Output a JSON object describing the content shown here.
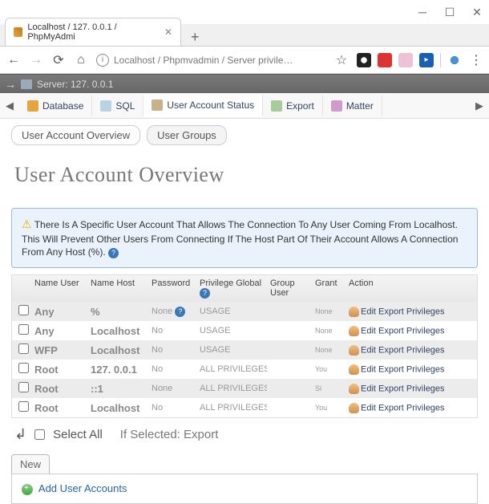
{
  "window": {
    "tab_title": "Localhost / 127. 0.0.1 / PhpMyAdmi",
    "url_text": "Localhost / Phpmvadmin / Server  privile…"
  },
  "serverbar": {
    "label": "Server: 127. 0.0.1"
  },
  "toolbar": {
    "database": "Database",
    "sql": "SQL",
    "user_status": "User Account Status",
    "export": "Export",
    "matter": "Matter"
  },
  "subtabs": {
    "overview": "User Account Overview",
    "groups": "User Groups"
  },
  "page_title": "User Account Overview",
  "notice": "There Is A Specific User Account That Allows The Connection To Any User Coming From Localhost. This Will Prevent Other Users From Connecting If The Host Part Of Their Account Allows A Connection From Any Host (%).",
  "headers": {
    "name_user": "Name User",
    "name_host": "Name Host",
    "password": "Password",
    "privilege": "Privilege Global",
    "group_user": "Group User",
    "grant": "Grant",
    "action": "Action"
  },
  "rows": [
    {
      "user": "Any",
      "host": "%",
      "pw": "None",
      "priv": "USAGE",
      "group": "",
      "grant": "None",
      "action": "Edit Export Privileges"
    },
    {
      "user": "Any",
      "host": "Localhost",
      "pw": "No",
      "priv": "USAGE",
      "group": "",
      "grant": "None",
      "action": "Edit Export Privileges"
    },
    {
      "user": "WFP",
      "host": "Localhost",
      "pw": "No",
      "priv": "USAGE",
      "group": "",
      "grant": "None",
      "action": "Edit Export Privileges"
    },
    {
      "user": "Root",
      "host": "127. 0.0.1",
      "pw": "No",
      "priv": "ALL PRIVILEGES",
      "group": "",
      "grant": "You",
      "action": "Edit Export Privileges"
    },
    {
      "user": "Root",
      "host": "::1",
      "pw": "None",
      "priv": "ALL PRIVILEGES",
      "group": "",
      "grant": "Si",
      "action": "Edit Export Privileges"
    },
    {
      "user": "Root",
      "host": "Localhost",
      "pw": "No",
      "priv": "ALL PRIVILEGES",
      "group": "",
      "grant": "You",
      "action": "Edit Export Privileges"
    }
  ],
  "selectall": {
    "label": "Select All",
    "if_selected": "If Selected: Export"
  },
  "new_section": {
    "badge": "New",
    "add_user": "Add User Accounts"
  }
}
